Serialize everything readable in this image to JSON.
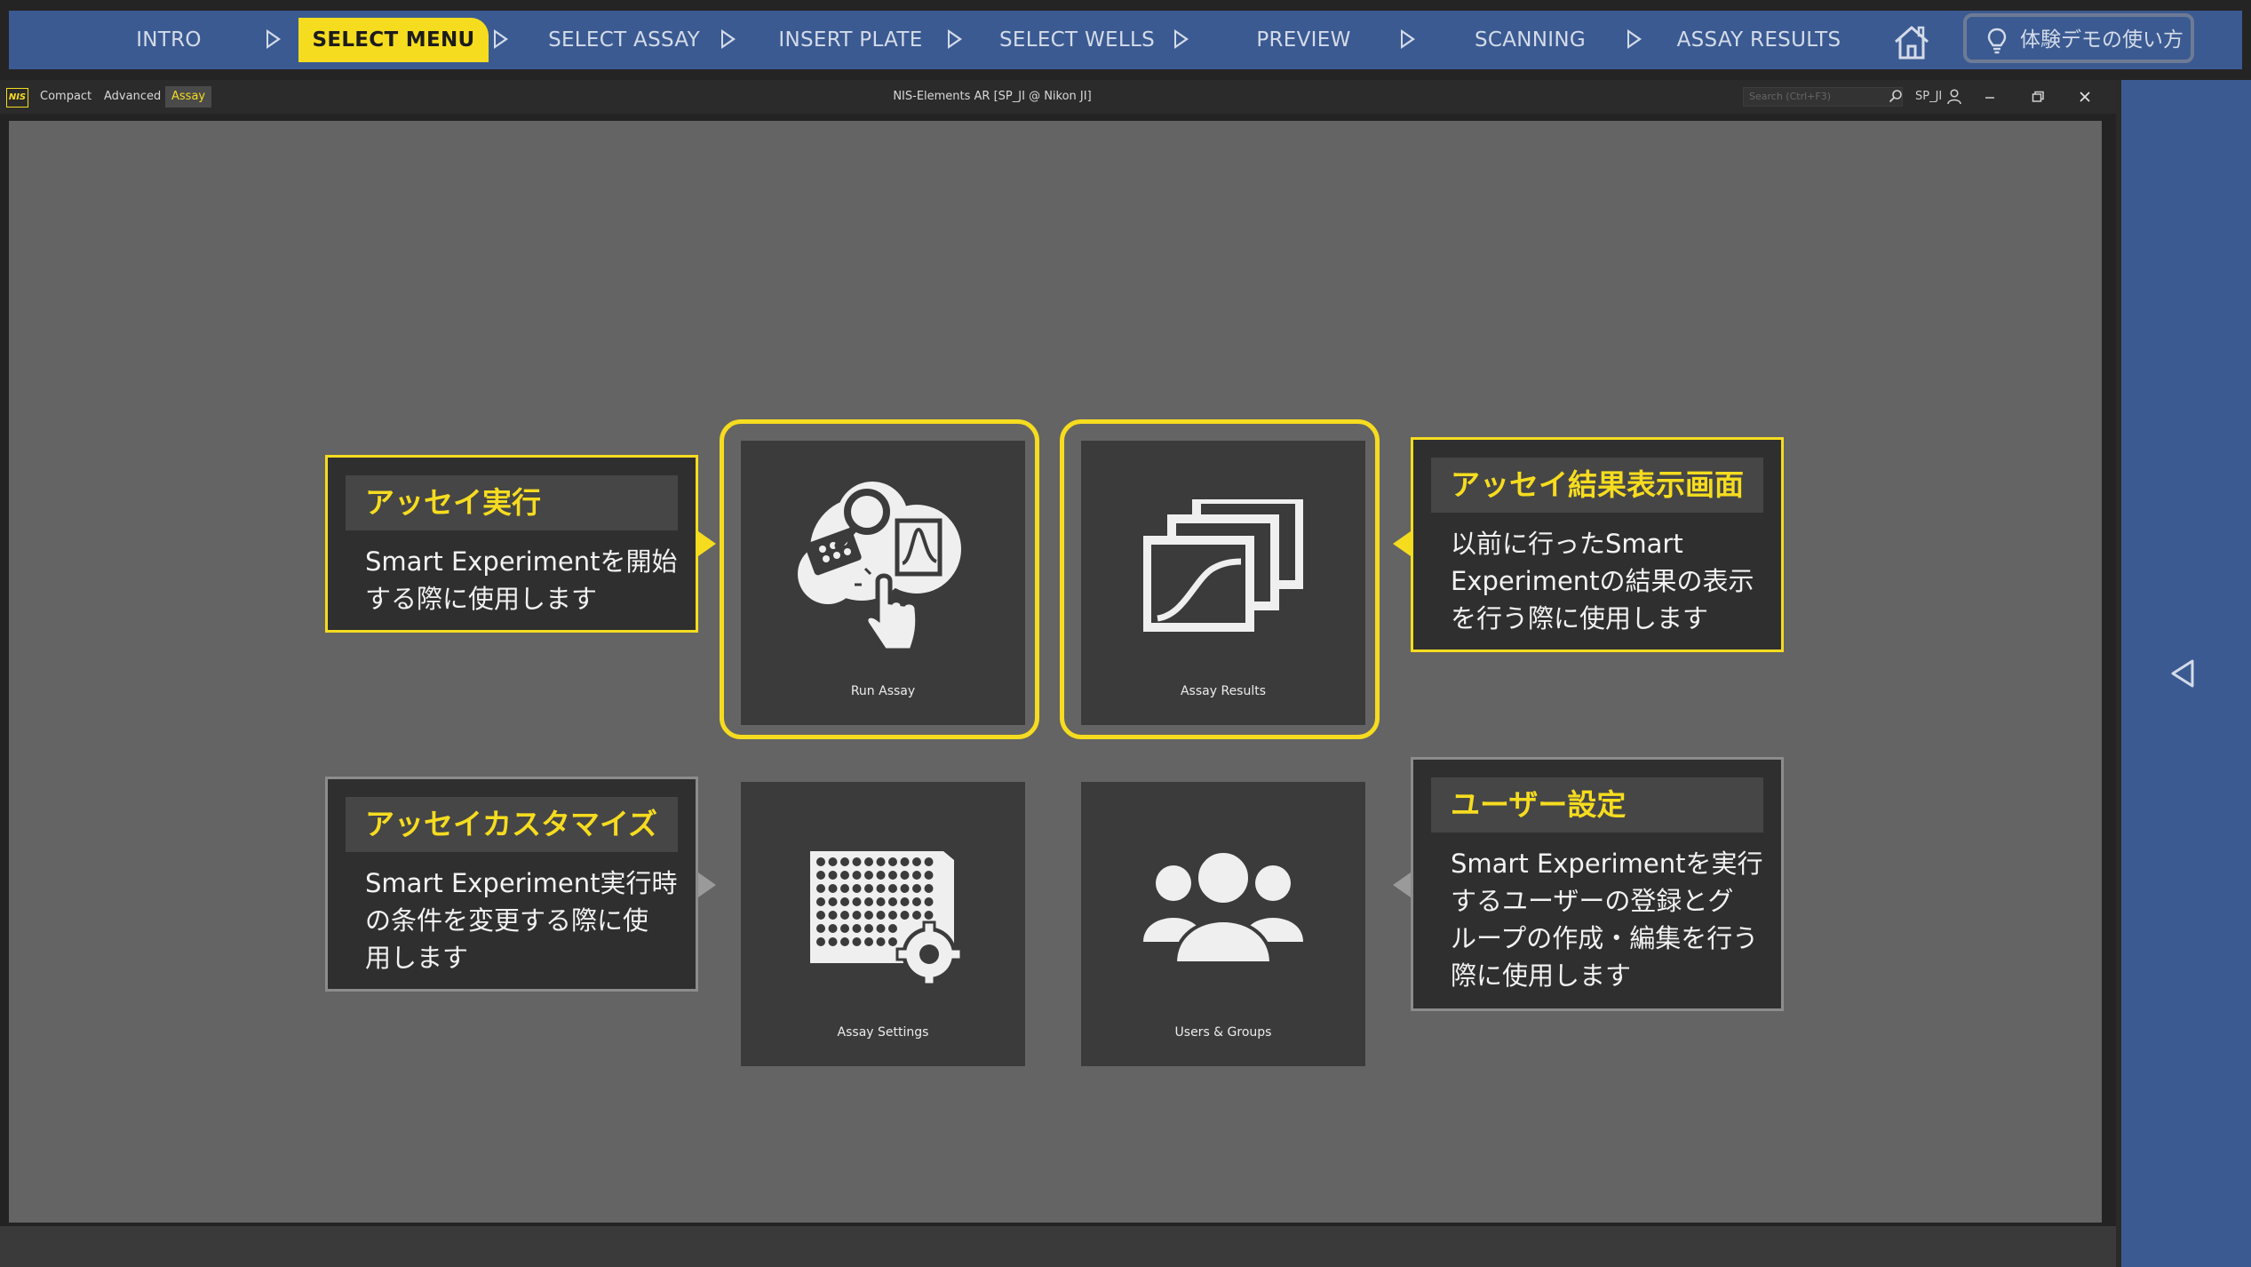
{
  "stepbar": {
    "steps": [
      {
        "label": "INTRO",
        "active": false
      },
      {
        "label": "SELECT MENU",
        "active": true
      },
      {
        "label": "SELECT ASSAY",
        "active": false
      },
      {
        "label": "INSERT PLATE",
        "active": false
      },
      {
        "label": "SELECT WELLS",
        "active": false
      },
      {
        "label": "PREVIEW",
        "active": false
      },
      {
        "label": "SCANNING",
        "active": false
      },
      {
        "label": "ASSAY RESULTS",
        "active": false
      }
    ],
    "home_icon": "home-icon",
    "demo_label": "体験デモの使い方",
    "demo_icon": "lightbulb-icon",
    "active_color": "#f6dc1f",
    "bar_color": "#3b5a92"
  },
  "app": {
    "logo_text": "NIS",
    "modes": [
      "Compact",
      "Advanced",
      "Assay"
    ],
    "active_mode": "Assay",
    "window_title": "NIS-Elements AR [SP_JI @ Nikon JI]",
    "search_placeholder": "Search (Ctrl+F3)",
    "user_label": "SP_JI",
    "window_controls": [
      "minimize-icon",
      "restore-icon",
      "close-icon"
    ]
  },
  "tiles": [
    {
      "caption": "Run Assay",
      "icon": "run-assay-icon",
      "highlighted": true
    },
    {
      "caption": "Assay Results",
      "icon": "assay-results-icon",
      "highlighted": true
    },
    {
      "caption": "Assay Settings",
      "icon": "assay-settings-icon",
      "highlighted": false
    },
    {
      "caption": "Users & Groups",
      "icon": "users-groups-icon",
      "highlighted": false
    }
  ],
  "callouts": {
    "run": {
      "title": "アッセイ実行",
      "body": "Smart Experimentを開始\nする際に使用します"
    },
    "results": {
      "title": "アッセイ結果表示画面",
      "body": "以前に行ったSmart\nExperimentの結果の表示\nを行う際に使用します"
    },
    "settings": {
      "title": "アッセイカスタマイズ",
      "body": "Smart Experiment実行時\nの条件を変更する際に使\n用します"
    },
    "users": {
      "title": "ユーザー設定",
      "body": "Smart Experimentを実行\nするユーザーの登録とグ\nループの作成・編集を行う\n際に使用します"
    }
  },
  "side_panel": {
    "toggle_icon": "collapse-left-icon"
  }
}
